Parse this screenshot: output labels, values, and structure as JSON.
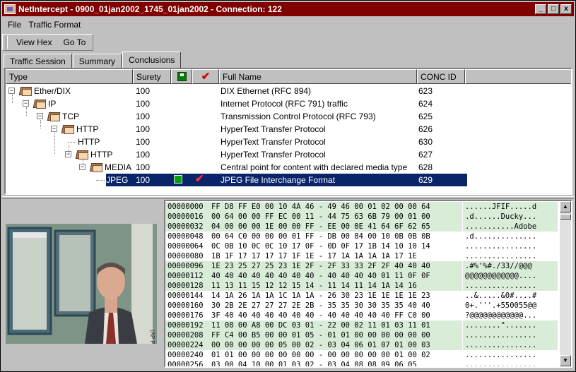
{
  "window": {
    "title": "NetIntercept - 0900_01jan2002_1745_01jan2002 - Connection:  122",
    "buttons": [
      "_",
      "□",
      "x"
    ]
  },
  "menubar": [
    "File",
    "Traffic Format"
  ],
  "toolbar": [
    "View Hex",
    "Go To"
  ],
  "tabs": [
    {
      "label": "Traffic Session",
      "active": false
    },
    {
      "label": "Summary",
      "active": false
    },
    {
      "label": "Conclusions",
      "active": true
    }
  ],
  "tree": {
    "columns": [
      "Type",
      "Surety",
      "saved-icon",
      "verified-icon",
      "Full Name",
      "CONC ID"
    ],
    "rows": [
      {
        "type": "Ether/DIX",
        "surety": "100",
        "saved": false,
        "verified": false,
        "full_name": "DIX Ethernet (RFC 894)",
        "conc_id": "623"
      },
      {
        "type": "IP",
        "surety": "100",
        "saved": false,
        "verified": false,
        "full_name": "Internet Protocol (RFC 791) traffic",
        "conc_id": "624"
      },
      {
        "type": "TCP",
        "surety": "100",
        "saved": false,
        "verified": false,
        "full_name": "Transmission Control Protocol (RFC 793)",
        "conc_id": "625"
      },
      {
        "type": "HTTP",
        "surety": "100",
        "saved": false,
        "verified": false,
        "full_name": "HyperText Transfer Protocol",
        "conc_id": "626"
      },
      {
        "type": "HTTP",
        "surety": "100",
        "saved": false,
        "verified": false,
        "full_name": "HyperText Transfer Protocol",
        "conc_id": "630"
      },
      {
        "type": "HTTP",
        "surety": "100",
        "saved": false,
        "verified": false,
        "full_name": "HyperText Transfer Protocol",
        "conc_id": "627"
      },
      {
        "type": "MEDIA",
        "surety": "100",
        "saved": false,
        "verified": false,
        "full_name": "Central point for content with declared media type",
        "conc_id": "628"
      },
      {
        "type": "JPEG",
        "surety": "100",
        "saved": true,
        "verified": true,
        "full_name": "JPEG File Interchange Format",
        "conc_id": "629",
        "selected": true
      }
    ]
  },
  "photo": {
    "caption": "(AP PHOTO)"
  },
  "hex": [
    {
      "off": "00000000",
      "hex": "FF D8 FF E0 00 10 4A 46 - 49 46 00 01 02 00 00 64",
      "ascii": "......JFIF.....d",
      "green": true
    },
    {
      "off": "00000016",
      "hex": "00 64 00 00 FF EC 00 11 - 44 75 63 6B 79 00 01 00",
      "ascii": ".d......Ducky...",
      "green": true
    },
    {
      "off": "00000032",
      "hex": "04 00 00 00 1E 00 00 FF - EE 00 0E 41 64 6F 62 65",
      "ascii": "...........Adobe",
      "green": true
    },
    {
      "off": "00000048",
      "hex": "00 64 C0 00 00 00 01 FF - DB 00 84 00 10 0B 0B 0B",
      "ascii": ".d..............",
      "green": false
    },
    {
      "off": "00000064",
      "hex": "0C 0B 10 0C 0C 10 17 0F - 0D 0F 17 1B 14 10 10 14",
      "ascii": "................",
      "green": false
    },
    {
      "off": "00000080",
      "hex": "1B 1F 17 17 17 17 1F 1E - 17 1A 1A 1A 1A 17 1E",
      "ascii": "................",
      "green": false
    },
    {
      "off": "00000096",
      "hex": "1E 23 25 27 25 23 1E 2F - 2F 33 33 2F 2F 40 40 40",
      "ascii": ".#%'%#./33//@@@",
      "green": true
    },
    {
      "off": "00000112",
      "hex": "40 40 40 40 40 40 40 40 - 40 40 40 40 01 11 0F 0F",
      "ascii": "@@@@@@@@@@@@....",
      "green": true
    },
    {
      "off": "00000128",
      "hex": "11 13 11 15 12 12 15 14 - 11 14 11 14 1A 14 16",
      "ascii": "................",
      "green": true
    },
    {
      "off": "00000144",
      "hex": "14 1A 26 1A 1A 1C 1A 1A - 26 30 23 1E 1E 1E 1E 23",
      "ascii": "..&.....&0#....#",
      "green": false
    },
    {
      "off": "00000160",
      "hex": "30 2B 2E 27 27 27 2E 2B - 35 35 30 30 35 35 40 40",
      "ascii": "0+.'''.+550055@@",
      "green": false
    },
    {
      "off": "00000176",
      "hex": "3F 40 40 40 40 40 40 40 - 40 40 40 40 40 FF C0 00",
      "ascii": "?@@@@@@@@@@@@...",
      "green": false
    },
    {
      "off": "00000192",
      "hex": "11 08 00 A8 00 DC 03 01 - 22 00 02 11 01 03 11 01",
      "ascii": "........\".......",
      "green": true
    },
    {
      "off": "00000208",
      "hex": "FF C4 00 B5 00 00 01 05 - 01 01 00 00 00 00 00 00",
      "ascii": "................",
      "green": true
    },
    {
      "off": "00000224",
      "hex": "00 00 00 00 00 05 00 02 - 03 04 06 01 07 01 00 03",
      "ascii": "................",
      "green": true
    },
    {
      "off": "00000240",
      "hex": "01 01 00 00 00 00 00 00 - 00 00 00 00 00 01 00 02",
      "ascii": "................",
      "green": false
    },
    {
      "off": "00000256",
      "hex": "03 00 04 10 00 01 03 02 - 03 04 08 08 09 06 05",
      "ascii": "................",
      "green": false
    }
  ]
}
